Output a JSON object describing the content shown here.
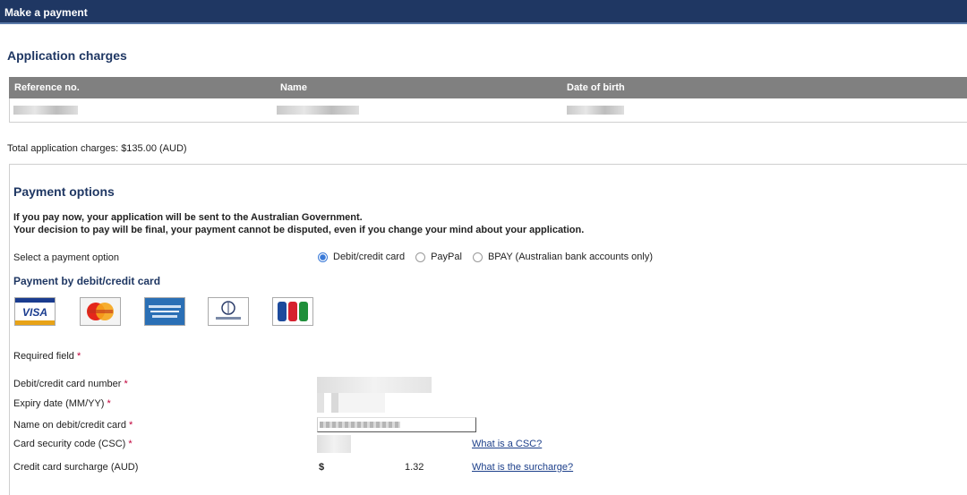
{
  "window": {
    "title": "Make a payment"
  },
  "application_charges": {
    "heading": "Application charges",
    "columns": [
      "Reference no.",
      "Name",
      "Date of birth"
    ],
    "total_text": "Total application charges: $135.00 (AUD)"
  },
  "payment_options": {
    "heading": "Payment options",
    "notice_line1": "If you pay now, your application will be sent to the Australian Government.",
    "notice_line2": "Your decision to pay will be final, your payment cannot be disputed, even if you change your mind about your application.",
    "select_label": "Select a payment option",
    "options": [
      {
        "label": "Debit/credit card",
        "selected": true
      },
      {
        "label": "PayPal",
        "selected": false
      },
      {
        "label": "BPAY (Australian bank accounts only)",
        "selected": false
      }
    ]
  },
  "card_section": {
    "heading": "Payment by debit/credit card",
    "cards": [
      {
        "name": "VISA",
        "icon": "visa-icon"
      },
      {
        "name": "MasterCard",
        "icon": "mastercard-icon"
      },
      {
        "name": "American Express",
        "icon": "amex-icon"
      },
      {
        "name": "Diners Club",
        "icon": "diners-club-icon"
      },
      {
        "name": "JCB",
        "icon": "jcb-icon"
      }
    ],
    "required_label": "Required field",
    "required_marker": "*",
    "fields": {
      "card_number_label": "Debit/credit card number",
      "expiry_label": "Expiry date (MM/YY)",
      "name_label": "Name on debit/credit card",
      "csc_label": "Card security code (CSC)",
      "surcharge_label": "Credit card surcharge (AUD)"
    },
    "surcharge_currency": "$",
    "surcharge_value": "1.32",
    "csc_help_link": "What is a CSC?",
    "surcharge_help_link": "What is the surcharge?"
  },
  "colors": {
    "header_bg": "#1f3763",
    "heading": "#1f3763",
    "table_header_bg": "#808080",
    "required": "#c0003a",
    "link": "#1c3f8a"
  }
}
